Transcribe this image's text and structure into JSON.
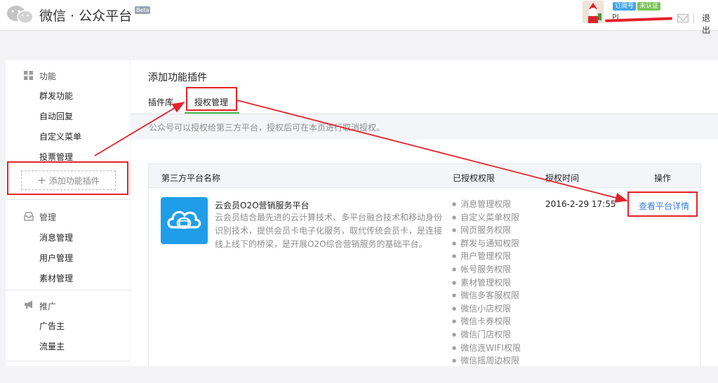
{
  "header": {
    "brand": "微信 · 公众平台",
    "beta": "Beta",
    "badge_subscription": "订阅号",
    "badge_unverified": "未认证",
    "account_name": "PI……",
    "logout": "退出"
  },
  "sidebar": {
    "sections": [
      {
        "title": "功能",
        "icon": "grid-icon",
        "items": [
          "群发功能",
          "自动回复",
          "自定义菜单",
          "投票管理"
        ]
      },
      {
        "title": "管理",
        "icon": "inbox-icon",
        "items": [
          "消息管理",
          "用户管理",
          "素材管理"
        ]
      },
      {
        "title": "推广",
        "icon": "megaphone-icon",
        "items": [
          "广告主",
          "流量主"
        ]
      }
    ],
    "add_plugin": "添加功能插件"
  },
  "main": {
    "title": "添加功能插件",
    "tabs": [
      "插件库",
      "授权管理"
    ],
    "active_tab": 1,
    "tip": "公众号可以授权给第三方平台，授权后可在本页进行取消授权。",
    "table": {
      "headers": [
        "第三方平台名称",
        "已授权权限",
        "授权时间",
        "操作"
      ],
      "row": {
        "name": "云会员O2O营销服务平台",
        "desc": "云会员结合最先进的云计算技术、多平台融合技术和移动身份识别技术，提供会员卡电子化服务，取代传统会员卡，是连接线上线下的桥梁，是开展O2O综合营销服务的基础平台。",
        "permissions": [
          "消息管理权限",
          "自定义菜单权限",
          "网页服务权限",
          "群发与通知权限",
          "用户管理权限",
          "帐号服务权限",
          "素材管理权限",
          "微信多客服权限",
          "微信小店权限",
          "微信卡券权限",
          "微信门店权限",
          "微信连WIFI权限",
          "微信摇周边权限"
        ],
        "time": "2016-2-29 17:55",
        "action": "查看平台详情"
      }
    }
  },
  "colors": {
    "accent_green": "#44b549",
    "link_blue": "#3a7dd8",
    "annotation_red": "#e3232b",
    "icon_blue": "#1f9de8"
  }
}
